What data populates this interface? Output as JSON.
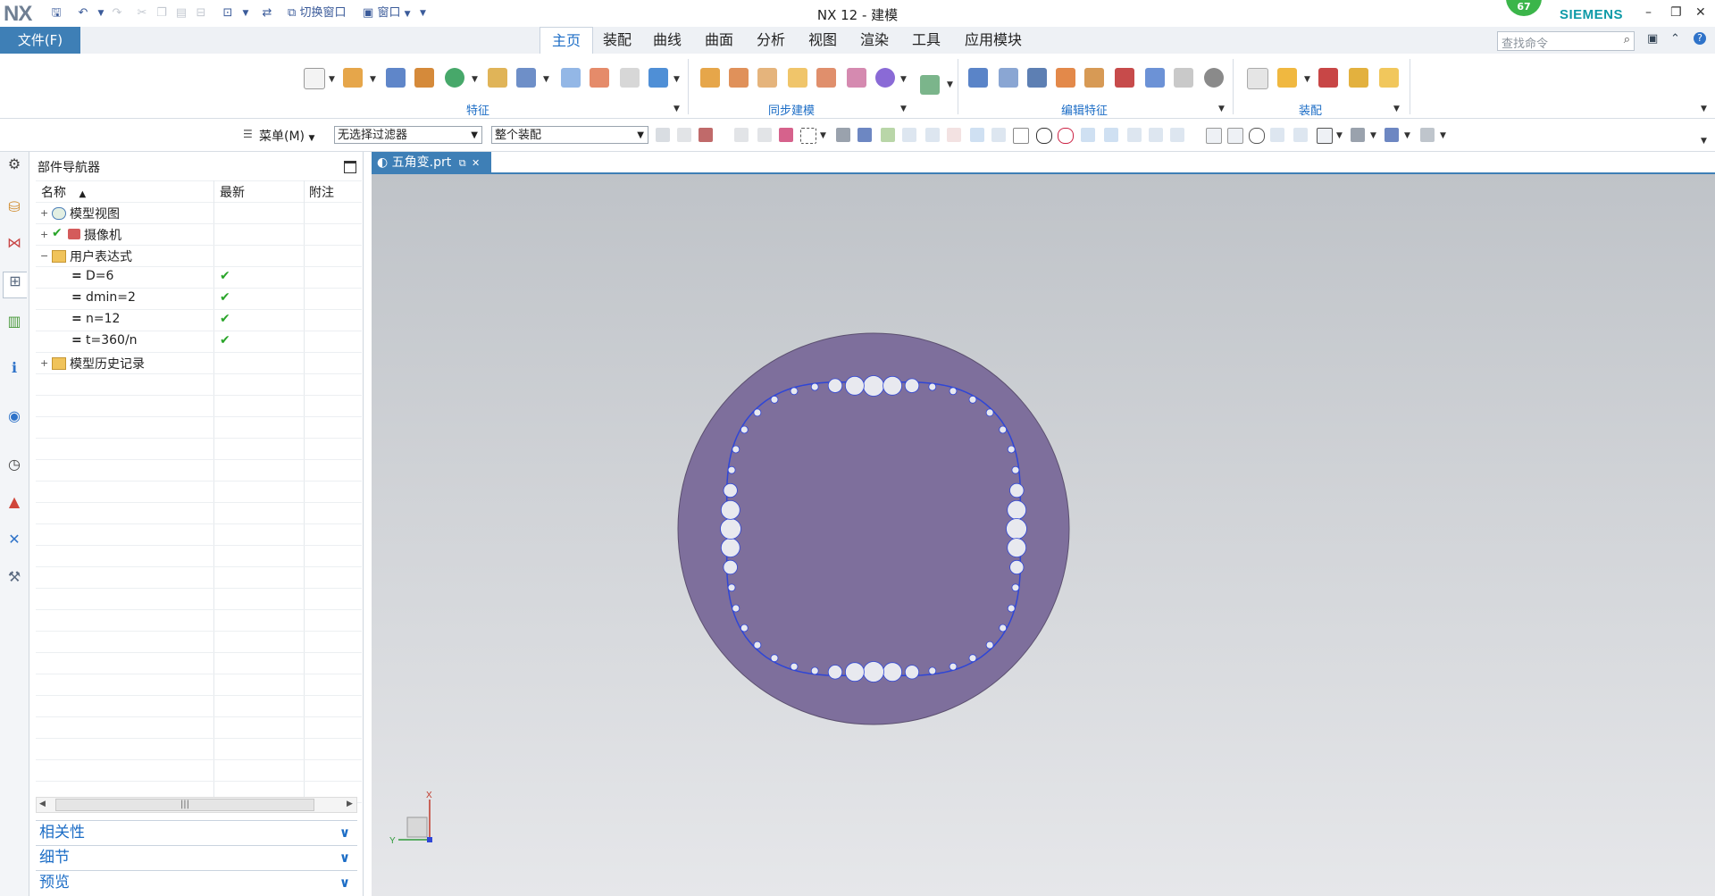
{
  "app": {
    "logo": "NX",
    "title": "NX 12 - 建模",
    "badge_count": "67",
    "brand": "SIEMENS"
  },
  "quick_access": {
    "switch_window_label": "切换窗口",
    "window_label": "窗口"
  },
  "ribbon": {
    "file_tab": "文件(F)",
    "tabs": [
      {
        "label": "主页",
        "active": true
      },
      {
        "label": "装配",
        "active": false
      },
      {
        "label": "曲线",
        "active": false
      },
      {
        "label": "曲面",
        "active": false
      },
      {
        "label": "分析",
        "active": false
      },
      {
        "label": "视图",
        "active": false
      },
      {
        "label": "渲染",
        "active": false
      },
      {
        "label": "工具",
        "active": false
      },
      {
        "label": "应用模块",
        "active": false
      }
    ],
    "search_placeholder": "查找命令",
    "groups": [
      {
        "label": "特征"
      },
      {
        "label": "同步建模"
      },
      {
        "label": "编辑特征"
      },
      {
        "label": "装配"
      }
    ]
  },
  "selection_bar": {
    "menu_label": "菜单(M)",
    "filter_value": "无选择过滤器",
    "scope_value": "整个装配"
  },
  "navigator": {
    "title": "部件导航器",
    "columns": [
      "名称",
      "最新",
      "附注"
    ],
    "rows": [
      {
        "label": "模型视图",
        "expander": "+",
        "check": ""
      },
      {
        "label": "摄像机",
        "expander": "+",
        "check": ""
      },
      {
        "label": "用户表达式",
        "expander": "−",
        "check": ""
      },
      {
        "label": "D=6",
        "expander": "",
        "check": "✔"
      },
      {
        "label": "dmin=2",
        "expander": "",
        "check": "✔"
      },
      {
        "label": "n=12",
        "expander": "",
        "check": "✔"
      },
      {
        "label": "t=360/n",
        "expander": "",
        "check": "✔"
      },
      {
        "label": "模型历史记录",
        "expander": "+",
        "check": ""
      }
    ],
    "panels": [
      {
        "label": "相关性"
      },
      {
        "label": "细节"
      },
      {
        "label": "预览"
      }
    ]
  },
  "graphics": {
    "doc_tab": "五角变.prt",
    "axis_x": "X",
    "axis_y": "Y"
  },
  "colors": {
    "accent": "#3e7fb6",
    "disk": "#7e6f9c",
    "curve": "#2f46d6"
  }
}
